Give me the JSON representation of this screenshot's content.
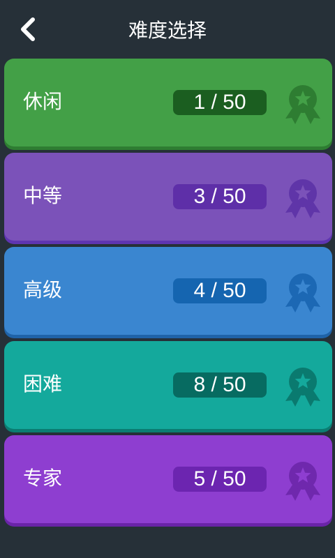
{
  "header": {
    "title": "难度选择",
    "back_icon": "chevron-left-icon"
  },
  "levels": [
    {
      "name": "休闲",
      "progress": "1 / 50",
      "colors": {
        "card": "#43a047",
        "edge": "#2e7d32",
        "pill": "#1b5e20",
        "medal": "#2e7d32"
      },
      "medal_icon": "medal-star-icon"
    },
    {
      "name": "中等",
      "progress": "3 / 50",
      "colors": {
        "card": "#7b52b9",
        "edge": "#5e35b1",
        "pill": "#5e2fa8",
        "medal": "#5f35a8"
      },
      "medal_icon": "medal-star-icon"
    },
    {
      "name": "高级",
      "progress": "4 / 50",
      "colors": {
        "card": "#3a86d0",
        "edge": "#1f63a8",
        "pill": "#1565b0",
        "medal": "#1c68b4"
      },
      "medal_icon": "medal-star-icon"
    },
    {
      "name": "困难",
      "progress": "8 / 50",
      "colors": {
        "card": "#14a99c",
        "edge": "#0b7d72",
        "pill": "#076b61",
        "medal": "#0a7a6f"
      },
      "medal_icon": "medal-star-icon"
    },
    {
      "name": "专家",
      "progress": "5 / 50",
      "colors": {
        "card": "#8e3ed0",
        "edge": "#6a24a8",
        "pill": "#6c25b0",
        "medal": "#6f28ad"
      },
      "medal_icon": "medal-star-icon"
    }
  ]
}
